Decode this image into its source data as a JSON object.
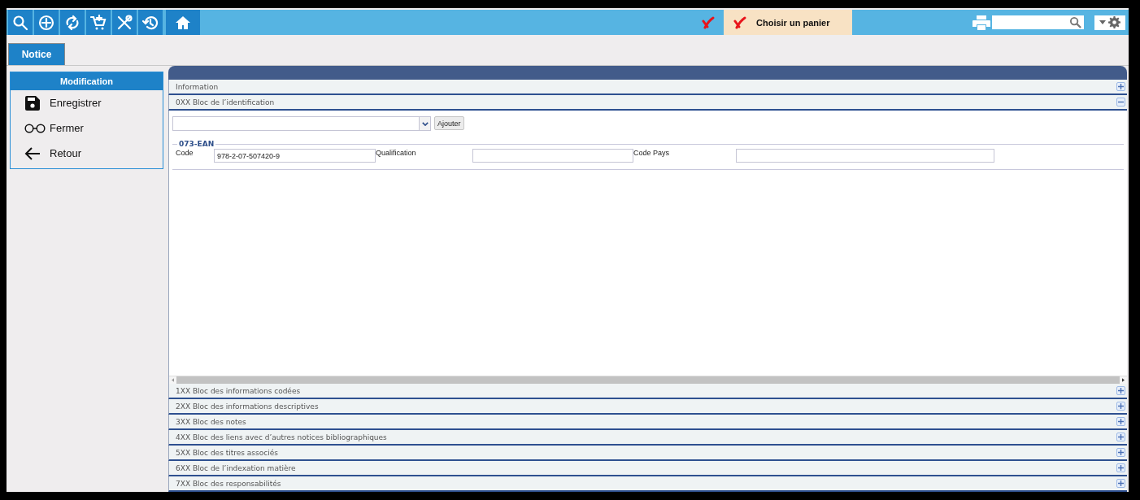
{
  "basket": {
    "label": "Choisir un panier"
  },
  "tabs": [
    {
      "label": "Notice",
      "selected": true
    }
  ],
  "side_panel": {
    "title": "Modification",
    "items": [
      {
        "label": "Enregistrer"
      },
      {
        "label": "Fermer"
      },
      {
        "label": "Retour"
      }
    ]
  },
  "sections": [
    {
      "title": "Information",
      "expanded": false
    },
    {
      "title": "0XX Bloc de l’identification",
      "expanded": true,
      "add_button": "Ajouter",
      "fieldset": {
        "legend": "073-EAN",
        "fields": [
          {
            "label": "Code",
            "value": "978-2-07-507420-9"
          },
          {
            "label": "Qualification"
          },
          {
            "label": "Code Pays"
          }
        ]
      }
    },
    {
      "title": "1XX Bloc des informations codées",
      "expanded": false
    },
    {
      "title": "2XX Bloc des informations descriptives",
      "expanded": false
    },
    {
      "title": "3XX Bloc des notes",
      "expanded": false
    },
    {
      "title": "4XX Bloc des liens avec d’autres notices bibliographiques",
      "expanded": false
    },
    {
      "title": "5XX Bloc des titres associés",
      "expanded": false
    },
    {
      "title": "6XX Bloc de l’indexation matière",
      "expanded": false
    },
    {
      "title": "7XX Bloc des responsabilités",
      "expanded": false
    }
  ]
}
